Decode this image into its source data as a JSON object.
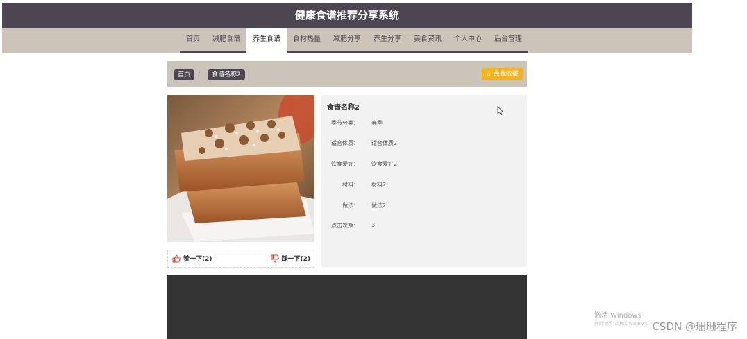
{
  "header": {
    "title": "健康食谱推荐分享系统"
  },
  "nav": {
    "items": [
      "首页",
      "减肥食谱",
      "养生食谱",
      "食材热量",
      "减肥分享",
      "养生分享",
      "美食资讯",
      "个人中心",
      "后台管理"
    ],
    "active": "养生食谱"
  },
  "breadcrumb": {
    "home": "首页",
    "separator": "/",
    "current": "食谱名称2"
  },
  "actions": {
    "favorite": "☆ 点我收藏"
  },
  "recipe": {
    "name": "食谱名称2",
    "fields": [
      {
        "label": "季节分类：",
        "value": "春季"
      },
      {
        "label": "适合体质：",
        "value": "适合体质2"
      },
      {
        "label": "饮食爱好：",
        "value": "饮食爱好2"
      },
      {
        "label": "材料：",
        "value": "材料2"
      },
      {
        "label": "做法：",
        "value": "做法2"
      },
      {
        "label": "点击次数：",
        "value": "3"
      }
    ]
  },
  "votes": {
    "like": "赞一下(2)",
    "dislike": "踩一下(2)"
  },
  "overlay": {
    "windows_line1": "激活 Windows",
    "windows_line2": "转到\"设置\"以激活 Windows。",
    "csdn": "CSDN @珊珊程序"
  },
  "colors": {
    "header": "#4b4650",
    "navbar": "#ccc3b9",
    "accent": "#f6b41a",
    "footer": "#333333"
  }
}
